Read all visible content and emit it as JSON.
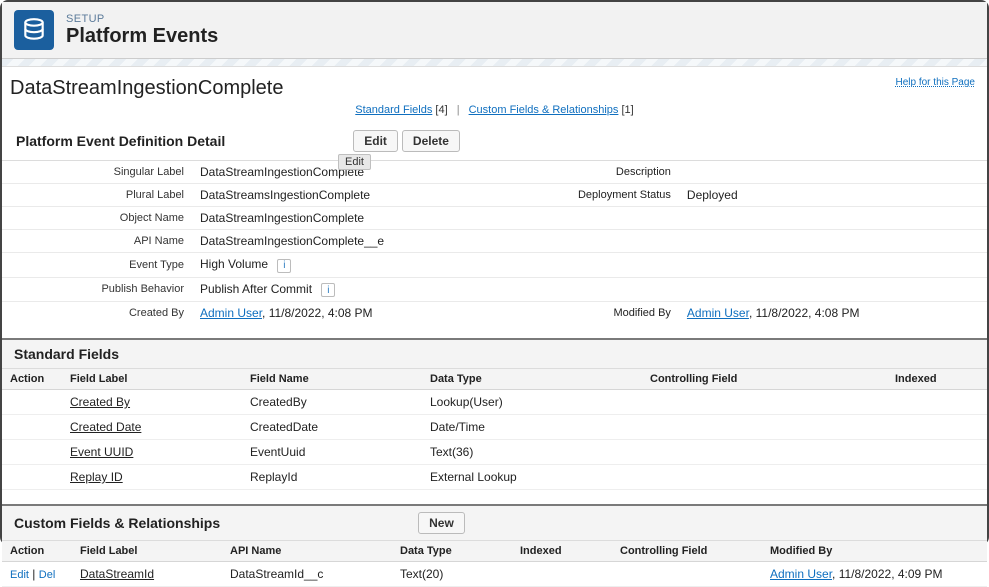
{
  "header": {
    "setup_label": "SETUP",
    "title": "Platform Events"
  },
  "page": {
    "title": "DataStreamIngestionComplete",
    "help_link": "Help for this Page"
  },
  "nav": {
    "standard_fields_label": "Standard Fields",
    "standard_fields_count": "[4]",
    "custom_fields_label": "Custom Fields & Relationships",
    "custom_fields_count": "[1]"
  },
  "detail": {
    "section_title": "Platform Event Definition Detail",
    "edit_btn": "Edit",
    "delete_btn": "Delete",
    "tooltip_edit": "Edit",
    "labels": {
      "singular": "Singular Label",
      "plural": "Plural Label",
      "object_name": "Object Name",
      "api_name": "API Name",
      "event_type": "Event Type",
      "publish_behavior": "Publish Behavior",
      "created_by": "Created By",
      "description": "Description",
      "deployment_status": "Deployment Status",
      "modified_by": "Modified By"
    },
    "values": {
      "singular": "DataStreamIngestionComplete",
      "plural": "DataStreamsIngestionComplete",
      "object_name": "DataStreamIngestionComplete",
      "api_name": "DataStreamIngestionComplete__e",
      "event_type": "High Volume",
      "publish_behavior": "Publish After Commit",
      "created_by_user": "Admin User",
      "created_by_ts": ", 11/8/2022, 4:08 PM",
      "description": "",
      "deployment_status": "Deployed",
      "modified_by_user": "Admin User",
      "modified_by_ts": ", 11/8/2022, 4:08 PM"
    }
  },
  "standard_fields": {
    "section_title": "Standard Fields",
    "columns": {
      "action": "Action",
      "label": "Field Label",
      "name": "Field Name",
      "type": "Data Type",
      "controlling": "Controlling Field",
      "indexed": "Indexed"
    },
    "rows": [
      {
        "label": "Created By",
        "name": "CreatedBy",
        "type": "Lookup(User)"
      },
      {
        "label": "Created Date",
        "name": "CreatedDate",
        "type": "Date/Time"
      },
      {
        "label": "Event UUID",
        "name": "EventUuid",
        "type": "Text(36)"
      },
      {
        "label": "Replay ID",
        "name": "ReplayId",
        "type": "External Lookup"
      }
    ]
  },
  "custom_fields": {
    "section_title": "Custom Fields & Relationships",
    "new_btn": "New",
    "columns": {
      "action": "Action",
      "label": "Field Label",
      "api_name": "API Name",
      "type": "Data Type",
      "indexed": "Indexed",
      "controlling": "Controlling Field",
      "modified_by": "Modified By"
    },
    "action_edit": "Edit",
    "action_sep": " | ",
    "action_del": "Del",
    "rows": [
      {
        "label": "DataStreamId",
        "api_name": "DataStreamId__c",
        "type": "Text(20)",
        "indexed": "",
        "controlling": "",
        "modified_by_user": "Admin User",
        "modified_by_ts": ", 11/8/2022, 4:09 PM"
      }
    ]
  }
}
